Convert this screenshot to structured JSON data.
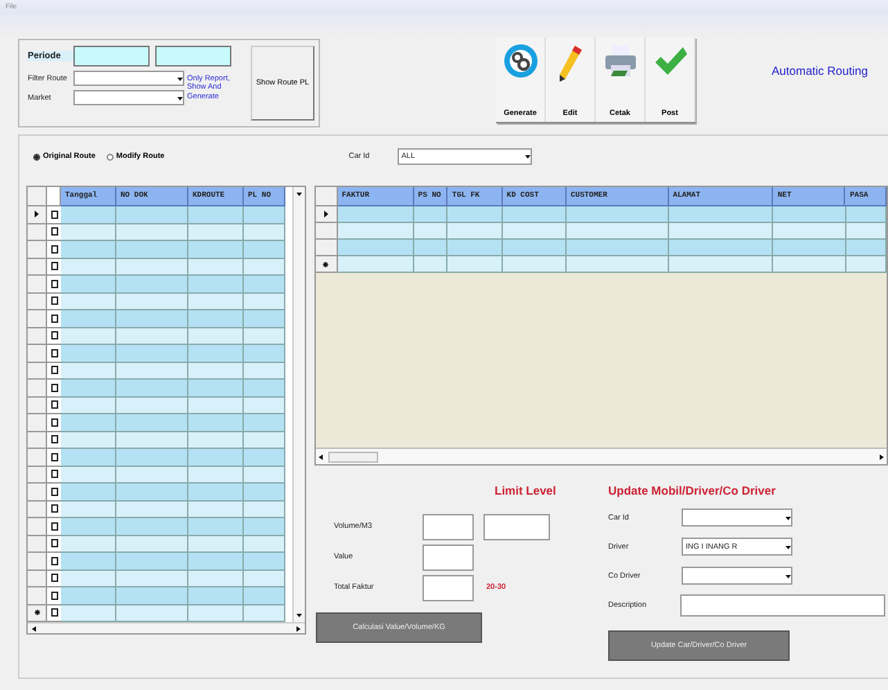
{
  "menu": [
    "File"
  ],
  "periode": {
    "label": "Periode"
  },
  "filters": [
    {
      "label": "Filter Route"
    },
    {
      "label": "Market"
    }
  ],
  "note": "Only Report, Show And Generate",
  "show_route_button": "Show Route PL",
  "toolbar": [
    {
      "kind": "generate",
      "label": "Generate"
    },
    {
      "kind": "edit",
      "label": "Edit"
    },
    {
      "kind": "print",
      "label": "Cetak"
    },
    {
      "kind": "post",
      "label": "Post"
    }
  ],
  "title": "Automatic Routing",
  "route_options": [
    {
      "label": "Original Route",
      "selected": true
    },
    {
      "label": "Modify Route",
      "selected": false
    }
  ],
  "car_filter": {
    "label": "Car Id",
    "value": "ALL"
  },
  "route_grid": {
    "columns": [
      "Tanggal",
      "NO DOK",
      "KDROUTE",
      "PL NO"
    ],
    "rows": [
      {
        "kind": "current",
        "checked": false
      },
      {
        "kind": "data",
        "checked": false
      },
      {
        "kind": "data",
        "checked": false
      },
      {
        "kind": "data",
        "checked": false
      },
      {
        "kind": "data",
        "checked": false
      },
      {
        "kind": "data",
        "checked": false
      },
      {
        "kind": "data",
        "checked": false
      },
      {
        "kind": "data",
        "checked": false
      },
      {
        "kind": "data",
        "checked": false
      },
      {
        "kind": "data",
        "checked": false
      },
      {
        "kind": "data",
        "checked": false
      },
      {
        "kind": "data",
        "checked": false
      },
      {
        "kind": "data",
        "checked": false
      },
      {
        "kind": "data",
        "checked": false
      },
      {
        "kind": "data",
        "checked": false
      },
      {
        "kind": "data",
        "checked": false
      },
      {
        "kind": "data",
        "checked": false
      },
      {
        "kind": "data",
        "checked": false
      },
      {
        "kind": "data",
        "checked": false
      },
      {
        "kind": "data",
        "checked": false
      },
      {
        "kind": "data",
        "checked": false
      },
      {
        "kind": "data",
        "checked": false
      },
      {
        "kind": "data",
        "checked": false
      },
      {
        "kind": "new",
        "checked": false
      }
    ]
  },
  "invoice_grid": {
    "columns": [
      "FAKTUR",
      "PS NO",
      "TGL FK",
      "KD COST",
      "CUSTOMER",
      "ALAMAT",
      "NET",
      "PASA"
    ],
    "rows": [
      {
        "kind": "current"
      },
      {
        "kind": "data"
      },
      {
        "kind": "data"
      },
      {
        "kind": "new"
      }
    ]
  },
  "limit_title": "Limit Level",
  "measures": [
    {
      "label": "Volume/M3",
      "limit_field": true
    },
    {
      "label": "Value",
      "limit_field": false
    },
    {
      "label": "Total Faktur",
      "limit_field": false,
      "limit": "20-30"
    }
  ],
  "calc_button": "Calculasi Value/Volume/KG",
  "update": {
    "title": "Update Mobil/Driver/Co Driver",
    "fields": [
      {
        "kind": "combo",
        "label": "Car Id"
      },
      {
        "kind": "combo",
        "label": "Driver",
        "value": "ING I INANG R"
      },
      {
        "kind": "combo",
        "label": "Co Driver"
      },
      {
        "kind": "text",
        "label": "Description"
      }
    ],
    "button": "Update Car/Driver/Co Driver"
  }
}
